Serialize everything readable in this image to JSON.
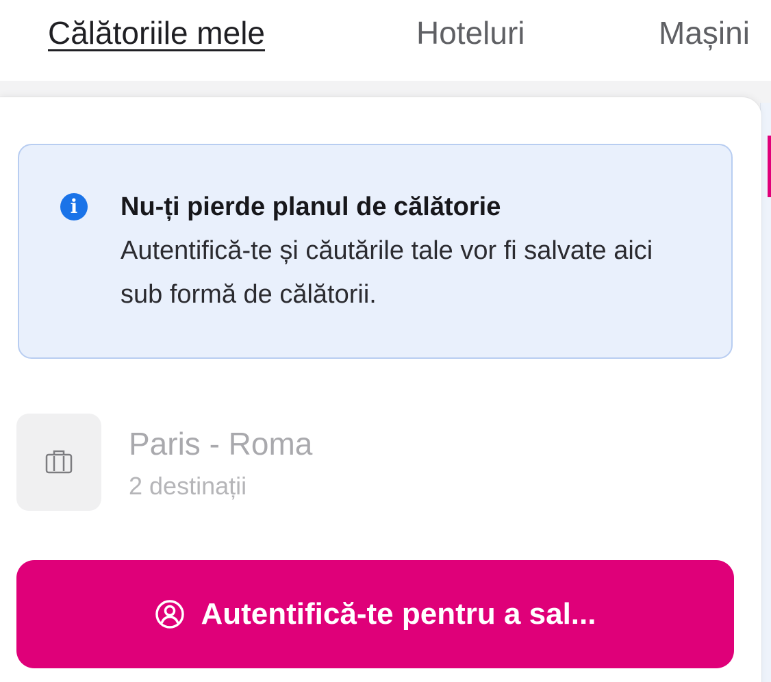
{
  "nav": {
    "tabs": [
      {
        "label": "Călătoriile mele",
        "active": true
      },
      {
        "label": "Hoteluri",
        "active": false
      },
      {
        "label": "Mașini",
        "active": false
      }
    ]
  },
  "info_box": {
    "icon": "info-icon",
    "title": "Nu-ți pierde planul de călătorie",
    "body": "Autentifică-te și căutările tale vor fi salvate aici sub formă de călătorii."
  },
  "trip": {
    "icon": "briefcase-icon",
    "title": "Paris - Roma",
    "subtitle": "2 destinații"
  },
  "login_button": {
    "icon": "user-circle-icon",
    "label": "Autentifică-te pentru a sal..."
  },
  "colors": {
    "accent": "#df0079",
    "info_background": "#e9f0fc",
    "info_border": "#b8cdf1",
    "info_icon": "#1a73e8"
  }
}
